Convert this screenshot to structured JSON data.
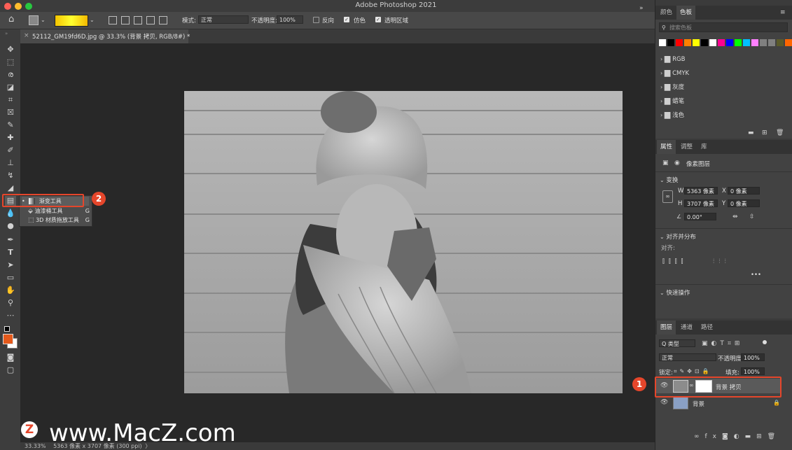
{
  "window": {
    "title": "Adobe Photoshop 2021",
    "traffic_colors": [
      "#fe5f57",
      "#febc2e",
      "#28c840"
    ]
  },
  "options": {
    "mode_label": "模式:",
    "mode_value": "正常",
    "opacity_label": "不透明度:",
    "opacity_value": "100%",
    "reverse_label": "反向",
    "dither_label": "仿色",
    "transparency_label": "透明区域"
  },
  "document": {
    "tab_title": "52112_GM19fd6D.jpg @ 33.3% (背景 拷贝, RGB/8#) *",
    "close_glyph": "×"
  },
  "status": {
    "zoom": "33.33%",
    "size": "5363 像素 x 3707 像素 (300 ppi)",
    "arrow": "〉"
  },
  "flyout": {
    "items": [
      {
        "label": "渐变工具",
        "shortcut": ""
      },
      {
        "label": "油漆桶工具",
        "shortcut": "G"
      },
      {
        "label": "3D 材质拖放工具",
        "shortcut": "G"
      }
    ]
  },
  "callouts": {
    "one": "1",
    "two": "2"
  },
  "swatches_panel": {
    "tabs": [
      "颜色",
      "色板"
    ],
    "search_placeholder": "搜索色板",
    "colors": [
      "#ffffff",
      "#000000",
      "#ff0000",
      "#ff8000",
      "#ffff00",
      "#000000",
      "#ffffff",
      "#ff0090",
      "#0000ff",
      "#00ff00",
      "#00c0ff",
      "#ff80ff",
      "#808080",
      "#808080",
      "#5a5a2a",
      "#ff6600"
    ],
    "groups": [
      "RGB",
      "CMYK",
      "灰度",
      "蜡笔",
      "浅色"
    ]
  },
  "properties_panel": {
    "tabs": [
      "属性",
      "调整",
      "库"
    ],
    "type_label": "像素图层",
    "transform_title": "变换",
    "w_label": "W",
    "w_value": "5363 像素",
    "x_label": "X",
    "x_value": "0 像素",
    "h_label": "H",
    "h_value": "3707 像素",
    "y_label": "Y",
    "y_value": "0 像素",
    "angle_value": "0.00°",
    "align_title": "对齐并分布",
    "align_label": "对齐:",
    "more": "•••",
    "quick_title": "快速操作"
  },
  "layers_panel": {
    "tabs": [
      "图层",
      "通道",
      "路径"
    ],
    "filter_label": "Q 类型",
    "blend_mode": "正常",
    "opacity_label": "不透明度:",
    "opacity_value": "100%",
    "lock_label": "锁定:",
    "fill_label": "填充:",
    "fill_value": "100%",
    "layers": [
      {
        "name": "背景 拷贝",
        "selected": true
      },
      {
        "name": "背景",
        "selected": false
      }
    ]
  },
  "watermark": {
    "logo": "Z",
    "text": "www.MacZ.com"
  }
}
